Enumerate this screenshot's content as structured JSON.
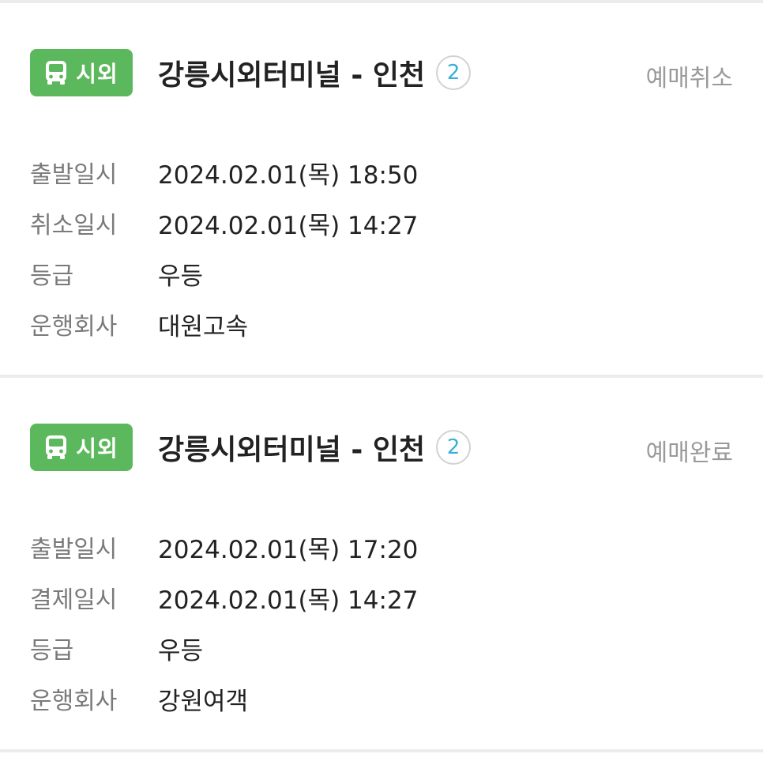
{
  "colors": {
    "badge_green": "#5cb85c",
    "count_blue": "#3aaed8",
    "status_gray": "#9a9a9a",
    "label_gray": "#7a7a7a",
    "divider": "#ececec"
  },
  "tickets": [
    {
      "badge": {
        "icon": "bus-icon",
        "label": "시외"
      },
      "route": "강릉시외터미널 - 인천",
      "passenger_count": "2",
      "status": "예매취소",
      "rows": [
        {
          "label": "출발일시",
          "value": "2024.02.01(목) 18:50"
        },
        {
          "label": "취소일시",
          "value": "2024.02.01(목) 14:27"
        },
        {
          "label": "등급",
          "value": "우등"
        },
        {
          "label": "운행회사",
          "value": "대원고속"
        }
      ]
    },
    {
      "badge": {
        "icon": "bus-icon",
        "label": "시외"
      },
      "route": "강릉시외터미널 - 인천",
      "passenger_count": "2",
      "status": "예매완료",
      "rows": [
        {
          "label": "출발일시",
          "value": "2024.02.01(목) 17:20"
        },
        {
          "label": "결제일시",
          "value": "2024.02.01(목) 14:27"
        },
        {
          "label": "등급",
          "value": "우등"
        },
        {
          "label": "운행회사",
          "value": "강원여객"
        }
      ]
    }
  ]
}
